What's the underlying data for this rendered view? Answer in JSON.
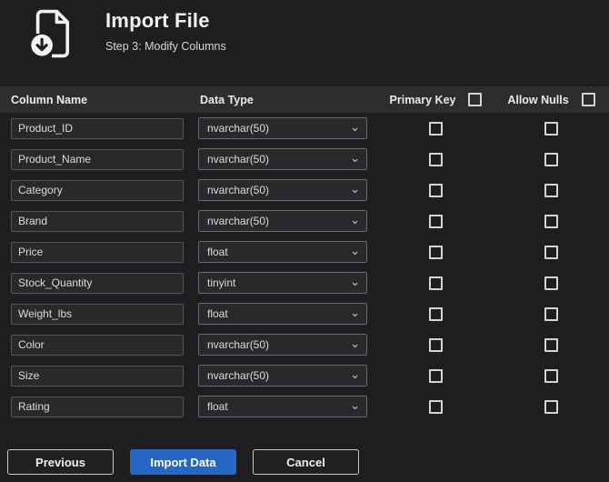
{
  "header": {
    "title": "Import File",
    "subtitle": "Step 3: Modify Columns",
    "icon": "file-download-icon"
  },
  "table": {
    "headers": {
      "column_name": "Column Name",
      "data_type": "Data Type",
      "primary_key": "Primary Key",
      "allow_nulls": "Allow Nulls"
    },
    "select_all": {
      "primary_key_checked": false,
      "allow_nulls_checked": false
    },
    "rows": [
      {
        "name": "Product_ID",
        "type": "nvarchar(50)",
        "primary_key": false,
        "allow_nulls": false
      },
      {
        "name": "Product_Name",
        "type": "nvarchar(50)",
        "primary_key": false,
        "allow_nulls": false
      },
      {
        "name": "Category",
        "type": "nvarchar(50)",
        "primary_key": false,
        "allow_nulls": false
      },
      {
        "name": "Brand",
        "type": "nvarchar(50)",
        "primary_key": false,
        "allow_nulls": false
      },
      {
        "name": "Price",
        "type": "float",
        "primary_key": false,
        "allow_nulls": false
      },
      {
        "name": "Stock_Quantity",
        "type": "tinyint",
        "primary_key": false,
        "allow_nulls": false
      },
      {
        "name": "Weight_lbs",
        "type": "float",
        "primary_key": false,
        "allow_nulls": false
      },
      {
        "name": "Color",
        "type": "nvarchar(50)",
        "primary_key": false,
        "allow_nulls": false
      },
      {
        "name": "Size",
        "type": "nvarchar(50)",
        "primary_key": false,
        "allow_nulls": false
      },
      {
        "name": "Rating",
        "type": "float",
        "primary_key": false,
        "allow_nulls": false
      }
    ]
  },
  "buttons": {
    "previous": "Previous",
    "import": "Import Data",
    "cancel": "Cancel"
  },
  "icons": {
    "dropdown_chevron": "⌄"
  },
  "colors": {
    "accent": "#2667c5",
    "header_strip": "#2d2d30",
    "background": "#1e1e20"
  }
}
